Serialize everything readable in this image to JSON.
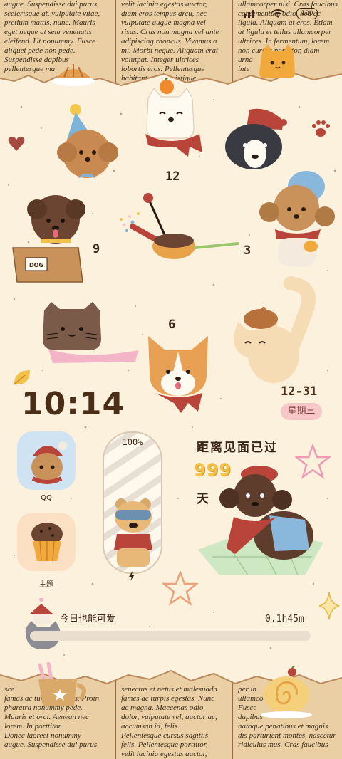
{
  "newspaper_top": {
    "col1": [
      "augue. Suspendisse dui purus,",
      "scelerisque at, vulputate vitae,",
      "pretium mattis, nunc. Mauris",
      "eget neque at sem venenatis",
      "eleifend. Ut nonummy. Fusce",
      "aliquet pede non pede.",
      "Suspendisse dapibus",
      "pellentesque ma"
    ],
    "col2": [
      "velit lacinia egestas auctor,",
      "diam eros tempus arcu, nec",
      "vulputate augue magna vel",
      "risus. Cras non magna vel ante",
      "adipiscing rhoncus. Vivamus a",
      "mi. Morbi neque. Aliquam erat",
      "volutpat. Integer ultrices",
      "lobortis eros. Pellentesque",
      "habitant morbi tristique"
    ],
    "col3": [
      "ullamcorper nisi. Cras faucibus",
      "condimentum odio. Sed ac",
      "ligula. Aliquam at eros. Etiam",
      "at ligula et tellus ullamcorper",
      "ultrices. In fermentum, lorem",
      "non cursus porttitor, diam",
      "urna",
      "inte"
    ]
  },
  "newspaper_bottom": {
    "col1": [
      "sce",
      "famas ac turpis egestas. Proin",
      "pharetra nonummy pede.",
      "Mauris et orci. Aenean nec",
      "lorem. In porttitor.",
      "Donec laoreet nonummy",
      "augue. Suspendisse dui purus,"
    ],
    "col2": [
      "senectus et netus et malesuada",
      "fames ac turpis egestas. Nunc",
      "ac magna. Maecenas odio",
      "dolor, vulputate vel, auctor ac,",
      "accumsan id, felis.",
      "Pellentesque cursus sagittis",
      "felis. Pellentesque porttitor,",
      "velit lacinia egestas auctor,"
    ],
    "col3": [
      "per in",
      "ullamco",
      "Fusce",
      "dapibus",
      "natoque penatibus et magnis",
      "dis parturient montes, nascetur",
      "ridiculus mus. Cras faucibus"
    ]
  },
  "clock": {
    "n12": "12",
    "n3": "3",
    "n6": "6",
    "n9": "9"
  },
  "time": "10:14",
  "date": "12-31",
  "weekday": "星期三",
  "apps": {
    "qq": "QQ",
    "theme": "主题"
  },
  "battery": {
    "percent_label": "100%",
    "level": 1.0
  },
  "countdown": {
    "title": "距离见面已过",
    "number": "999",
    "unit": "天"
  },
  "status": {
    "battery_text": "100"
  },
  "progress": {
    "label": "今日也能可爱",
    "time_text": "0.1h45m",
    "fill": 0.0
  },
  "colors": {
    "paper": "#fbf1dd",
    "ink": "#3b2617",
    "pink_badge": "#f7c6c6",
    "scarf_red": "#b8443a"
  }
}
